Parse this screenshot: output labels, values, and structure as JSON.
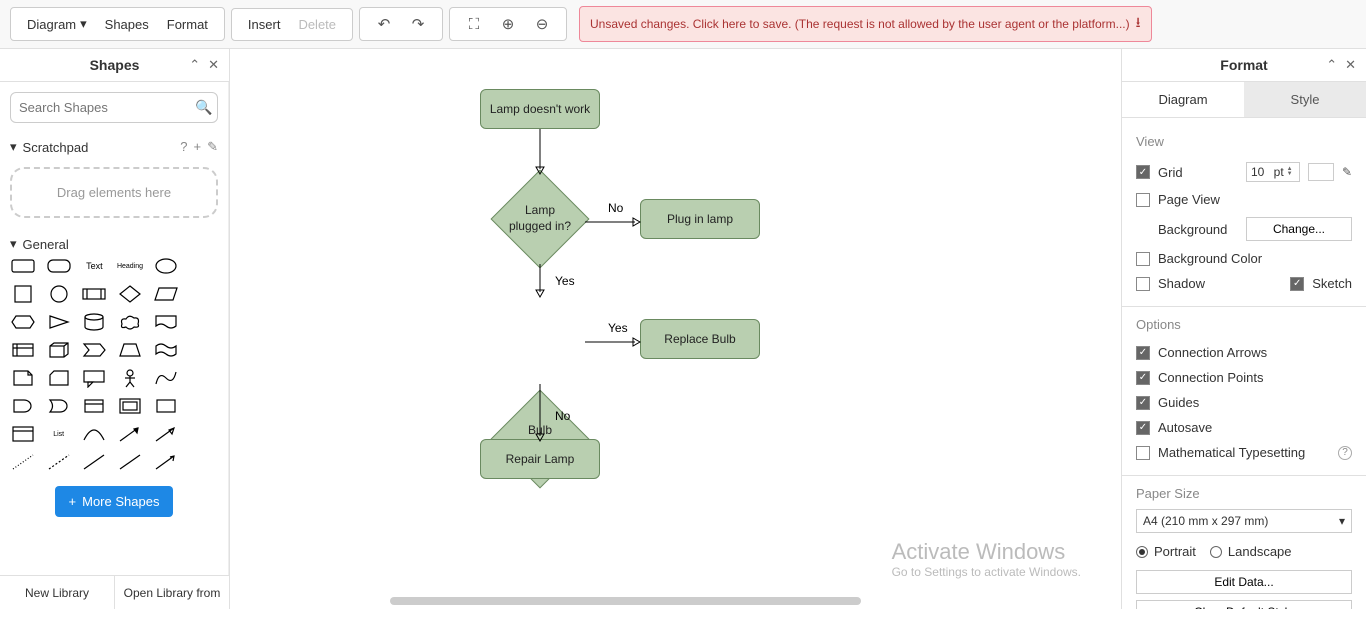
{
  "toolbar": {
    "diagram": "Diagram",
    "shapes": "Shapes",
    "format": "Format",
    "insert": "Insert",
    "delete": "Delete",
    "alert": "Unsaved changes. Click here to save. (The request is not allowed by the user agent or the platform...)"
  },
  "left": {
    "title": "Shapes",
    "search_placeholder": "Search Shapes",
    "scratchpad": "Scratchpad",
    "dropzone": "Drag elements here",
    "general": "General",
    "text_label": "Text",
    "heading_label": "Heading",
    "list_label": "List",
    "more": "More Shapes",
    "new_lib": "New Library",
    "open_lib": "Open Library from"
  },
  "flow": {
    "n1": "Lamp doesn't work",
    "n2": "Lamp\nplugged in?",
    "n3": "Plug in lamp",
    "n4": "Bulb\nburned out?",
    "n5": "Replace Bulb",
    "n6": "Repair Lamp",
    "no": "No",
    "yes": "Yes"
  },
  "right": {
    "title": "Format",
    "tab_diagram": "Diagram",
    "tab_style": "Style",
    "view": "View",
    "grid": "Grid",
    "grid_val": "10",
    "grid_unit": "pt",
    "pageview": "Page View",
    "background": "Background",
    "change": "Change...",
    "bgcolor": "Background Color",
    "shadow": "Shadow",
    "sketch": "Sketch",
    "options": "Options",
    "conn_arrows": "Connection Arrows",
    "conn_points": "Connection Points",
    "guides": "Guides",
    "autosave": "Autosave",
    "math": "Mathematical Typesetting",
    "paper": "Paper Size",
    "paper_val": "A4 (210 mm x 297 mm)",
    "portrait": "Portrait",
    "landscape": "Landscape",
    "edit_data": "Edit Data...",
    "clear_style": "Clear Default Style"
  },
  "watermark": {
    "l1": "Activate Windows",
    "l2": "Go to Settings to activate Windows."
  }
}
